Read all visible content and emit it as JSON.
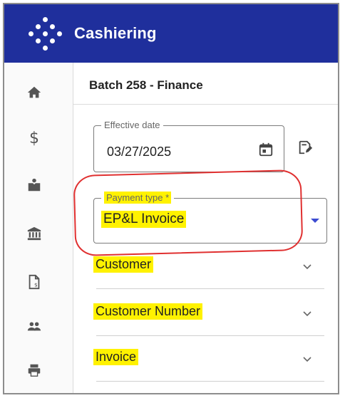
{
  "app": {
    "title": "Cashiering"
  },
  "batch": {
    "title": "Batch 258 - Finance"
  },
  "effective_date": {
    "label": "Effective date",
    "value": "03/27/2025"
  },
  "payment_type": {
    "label": "Payment type *",
    "value": "EP&L Invoice"
  },
  "accordions": [
    {
      "label": "Customer"
    },
    {
      "label": "Customer Number"
    },
    {
      "label": "Invoice"
    }
  ],
  "sidebar": {
    "items": [
      {
        "icon": "home-icon"
      },
      {
        "icon": "dollar-icon",
        "glyph": "$"
      },
      {
        "icon": "cash-register-icon"
      },
      {
        "icon": "bank-icon"
      },
      {
        "icon": "receipt-document-icon"
      },
      {
        "icon": "users-icon"
      },
      {
        "icon": "printer-icon"
      }
    ]
  },
  "colors": {
    "appbar": "#1f2f9c",
    "highlight": "#fff200",
    "annotation": "#e03030",
    "caret": "#3b4bd1"
  }
}
